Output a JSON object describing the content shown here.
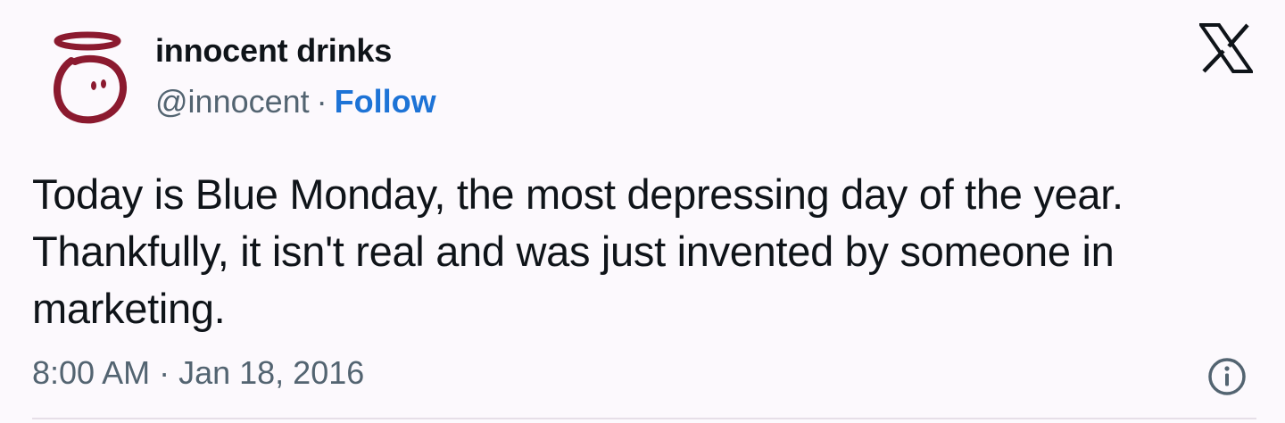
{
  "author": {
    "name": "innocent drinks",
    "handle": "@innocent",
    "separator": "·",
    "follow_label": "Follow"
  },
  "tweet": {
    "text": "Today is Blue Monday, the most depressing day of the year. Thankfully, it isn't real and was just invented by someone in marketing.",
    "time": "8:00 AM",
    "separator": "·",
    "date": "Jan 18, 2016"
  },
  "icons": {
    "avatar": "innocent-logo-icon",
    "platform": "x-logo-icon",
    "info": "info-icon"
  },
  "colors": {
    "background": "#fcf9fd",
    "text": "#0f1419",
    "secondary_text": "#536471",
    "follow": "#1d73d6",
    "brand_logo": "#8b1a2f"
  }
}
